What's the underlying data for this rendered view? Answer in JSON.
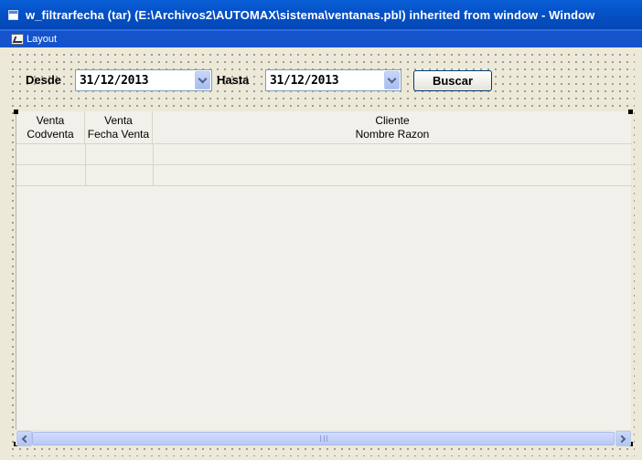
{
  "window": {
    "title": "w_filtrarfecha (tar) (E:\\Archivos2\\AUTOMAX\\sistema\\ventanas.pbl) inherited from window - Window",
    "panel_title": "Layout"
  },
  "filters": {
    "desde_label": "Desde",
    "desde_value": "31/12/2013",
    "hasta_label": "Hasta",
    "hasta_value": "31/12/2013",
    "search_button": "Buscar"
  },
  "grid": {
    "columns": [
      {
        "line1": "Venta",
        "line2": "Codventa"
      },
      {
        "line1": "Venta",
        "line2": "Fecha Venta"
      },
      {
        "line1": "Cliente",
        "line2": "Nombre Razon"
      }
    ]
  }
}
